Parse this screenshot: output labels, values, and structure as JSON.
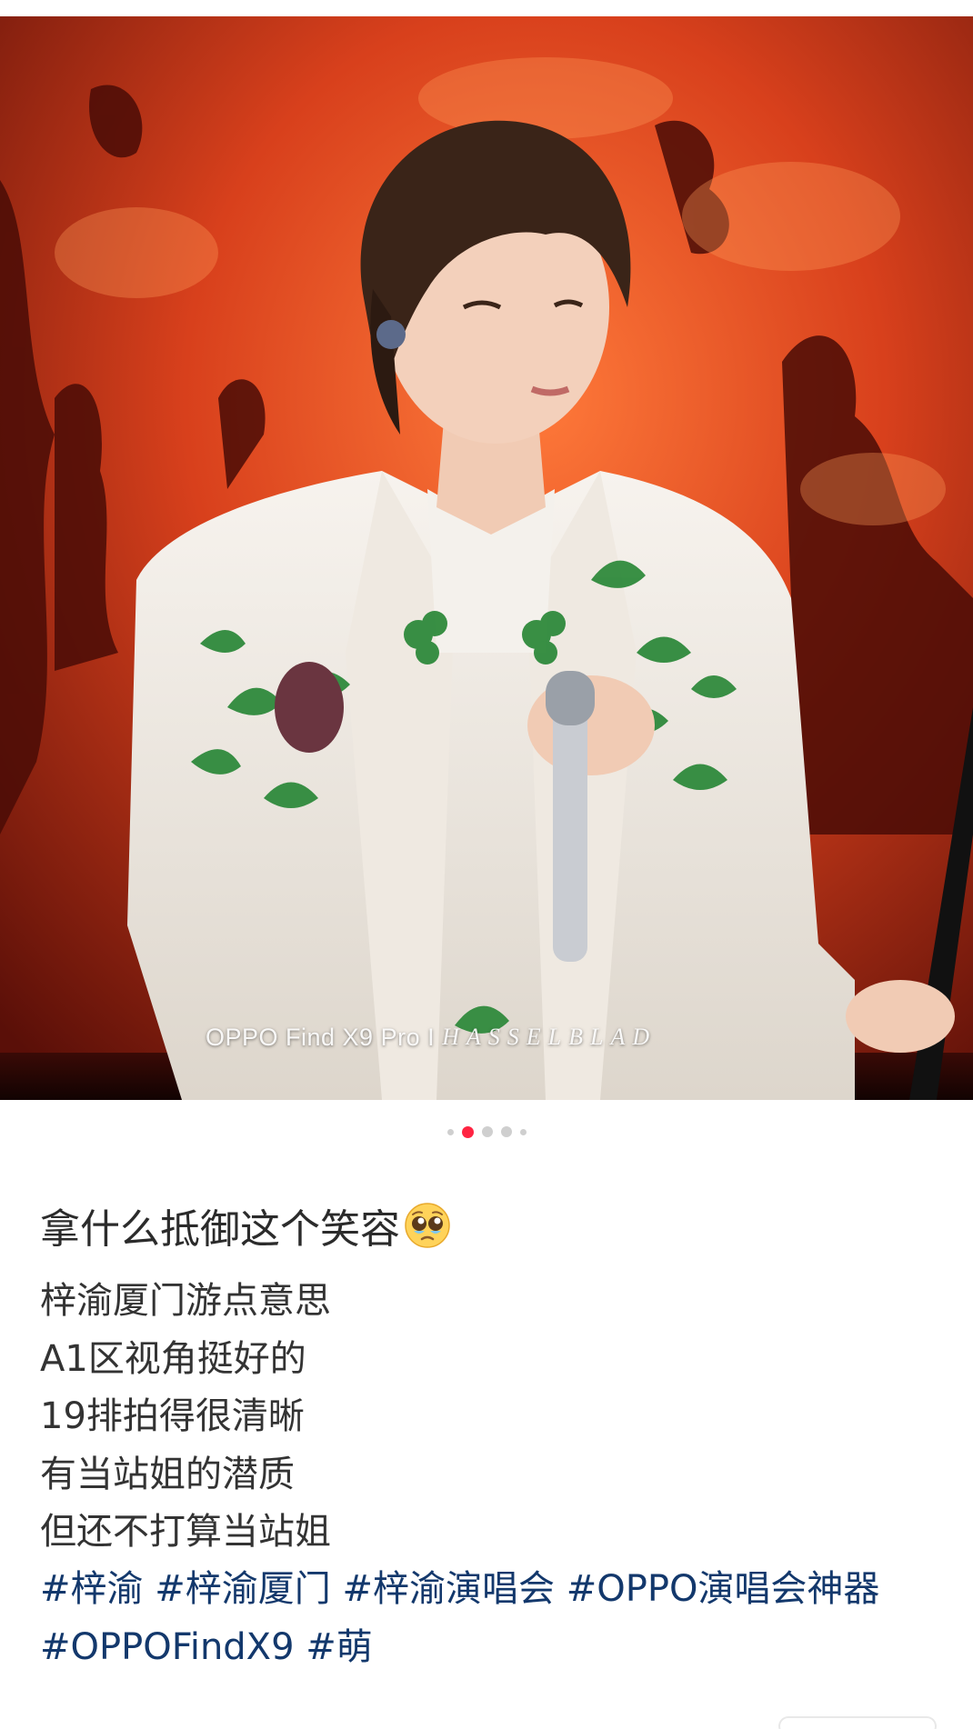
{
  "photo": {
    "alt_icon": "concert-photo",
    "watermark": {
      "device": "OPPO Find X9 Pro",
      "separator": "I",
      "brand": "HASSELBLAD"
    }
  },
  "carousel": {
    "count": 5,
    "active_index": 1
  },
  "post": {
    "title": "拿什么抵御这个笑容",
    "title_emoji": "pleading-face-emoji",
    "lines": [
      "梓渝厦门游点意思",
      "A1区视角挺好的",
      "19排拍得很清晰",
      "有当站姐的潜质",
      "但还不打算当站姐"
    ],
    "tags": [
      "#梓渝",
      "#梓渝厦门",
      "#梓渝演唱会",
      "#OPPO演唱会神器",
      "#OPPOFindX9",
      "#萌"
    ]
  },
  "colors": {
    "accent": "#ff2442",
    "tag": "#13386c",
    "text": "#333333"
  }
}
